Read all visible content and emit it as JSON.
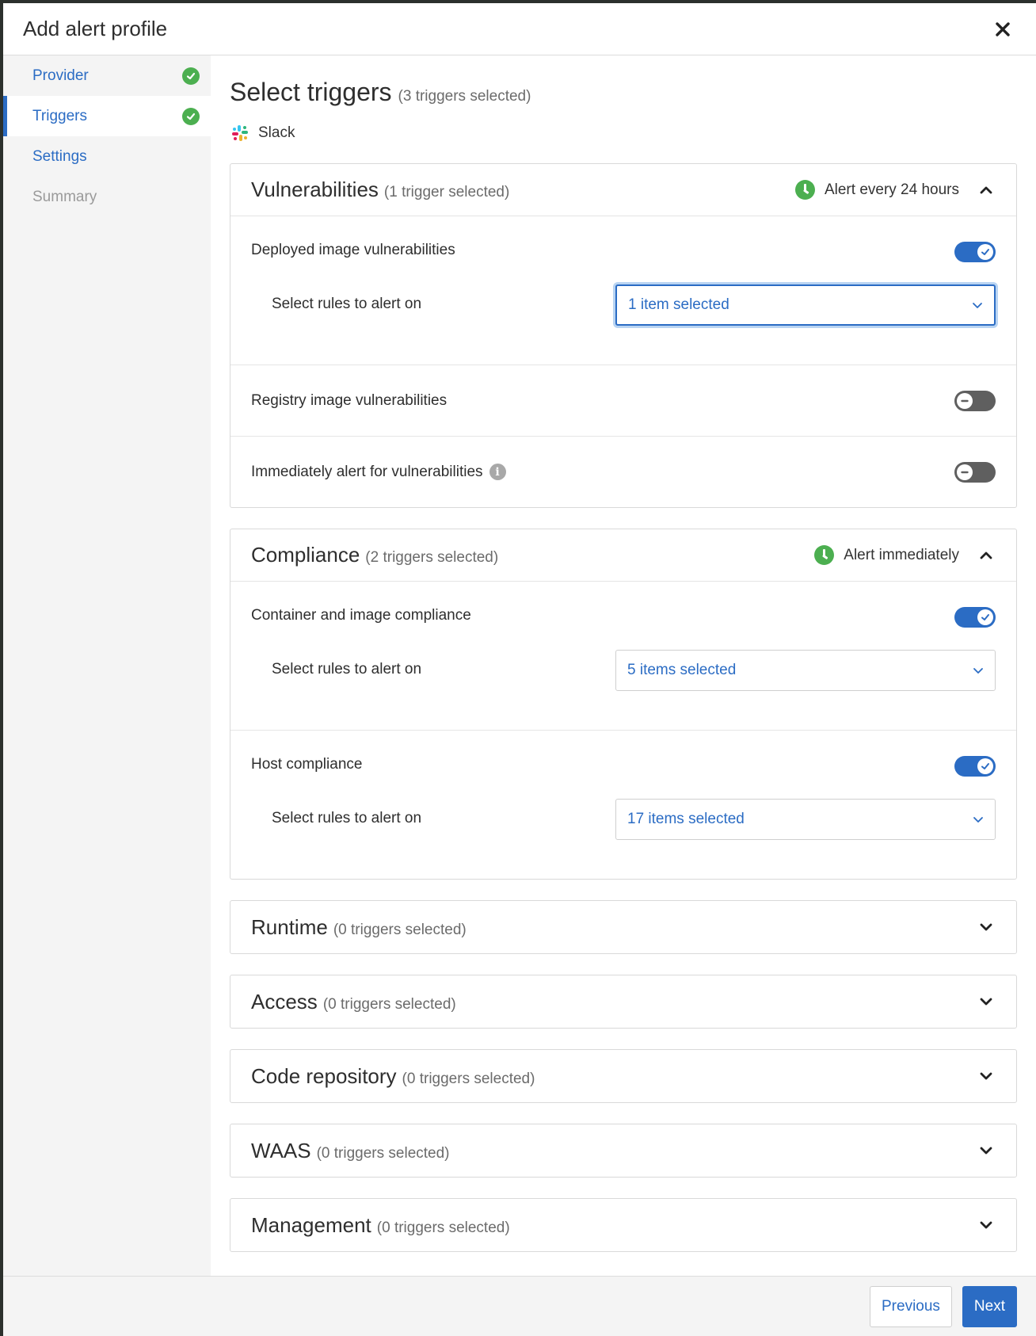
{
  "modal": {
    "title": "Add alert profile"
  },
  "sidebar": {
    "items": [
      {
        "label": "Provider",
        "state": "complete"
      },
      {
        "label": "Triggers",
        "state": "active-complete"
      },
      {
        "label": "Settings",
        "state": "pending"
      },
      {
        "label": "Summary",
        "state": "disabled"
      }
    ]
  },
  "main": {
    "title": "Select triggers",
    "subtitle": "(3 triggers selected)",
    "provider": {
      "name": "Slack",
      "icon": "slack-icon"
    }
  },
  "sections": [
    {
      "title": "Vulnerabilities",
      "count": "(1 trigger selected)",
      "frequency": "Alert every 24 hours",
      "expanded": true,
      "triggers": [
        {
          "label": "Deployed image vulnerabilities",
          "enabled": true,
          "rules_label": "Select rules to alert on",
          "rules_value": "1 item selected"
        },
        {
          "label": "Registry image vulnerabilities",
          "enabled": false
        },
        {
          "label": "Immediately alert for vulnerabilities",
          "enabled": false,
          "info": true
        }
      ]
    },
    {
      "title": "Compliance",
      "count": "(2 triggers selected)",
      "frequency": "Alert immediately",
      "expanded": true,
      "triggers": [
        {
          "label": "Container and image compliance",
          "enabled": true,
          "rules_label": "Select rules to alert on",
          "rules_value": "5 items selected"
        },
        {
          "label": "Host compliance",
          "enabled": true,
          "rules_label": "Select rules to alert on",
          "rules_value": "17 items selected"
        }
      ]
    },
    {
      "title": "Runtime",
      "count": "(0 triggers selected)",
      "expanded": false
    },
    {
      "title": "Access",
      "count": "(0 triggers selected)",
      "expanded": false
    },
    {
      "title": "Code repository",
      "count": "(0 triggers selected)",
      "expanded": false
    },
    {
      "title": "WAAS",
      "count": "(0 triggers selected)",
      "expanded": false
    },
    {
      "title": "Management",
      "count": "(0 triggers selected)",
      "expanded": false
    }
  ],
  "footer": {
    "previous_label": "Previous",
    "next_label": "Next"
  },
  "colors": {
    "accent": "#2b6cc4",
    "success": "#4caf50",
    "toggle_off": "#5f5f5f"
  }
}
